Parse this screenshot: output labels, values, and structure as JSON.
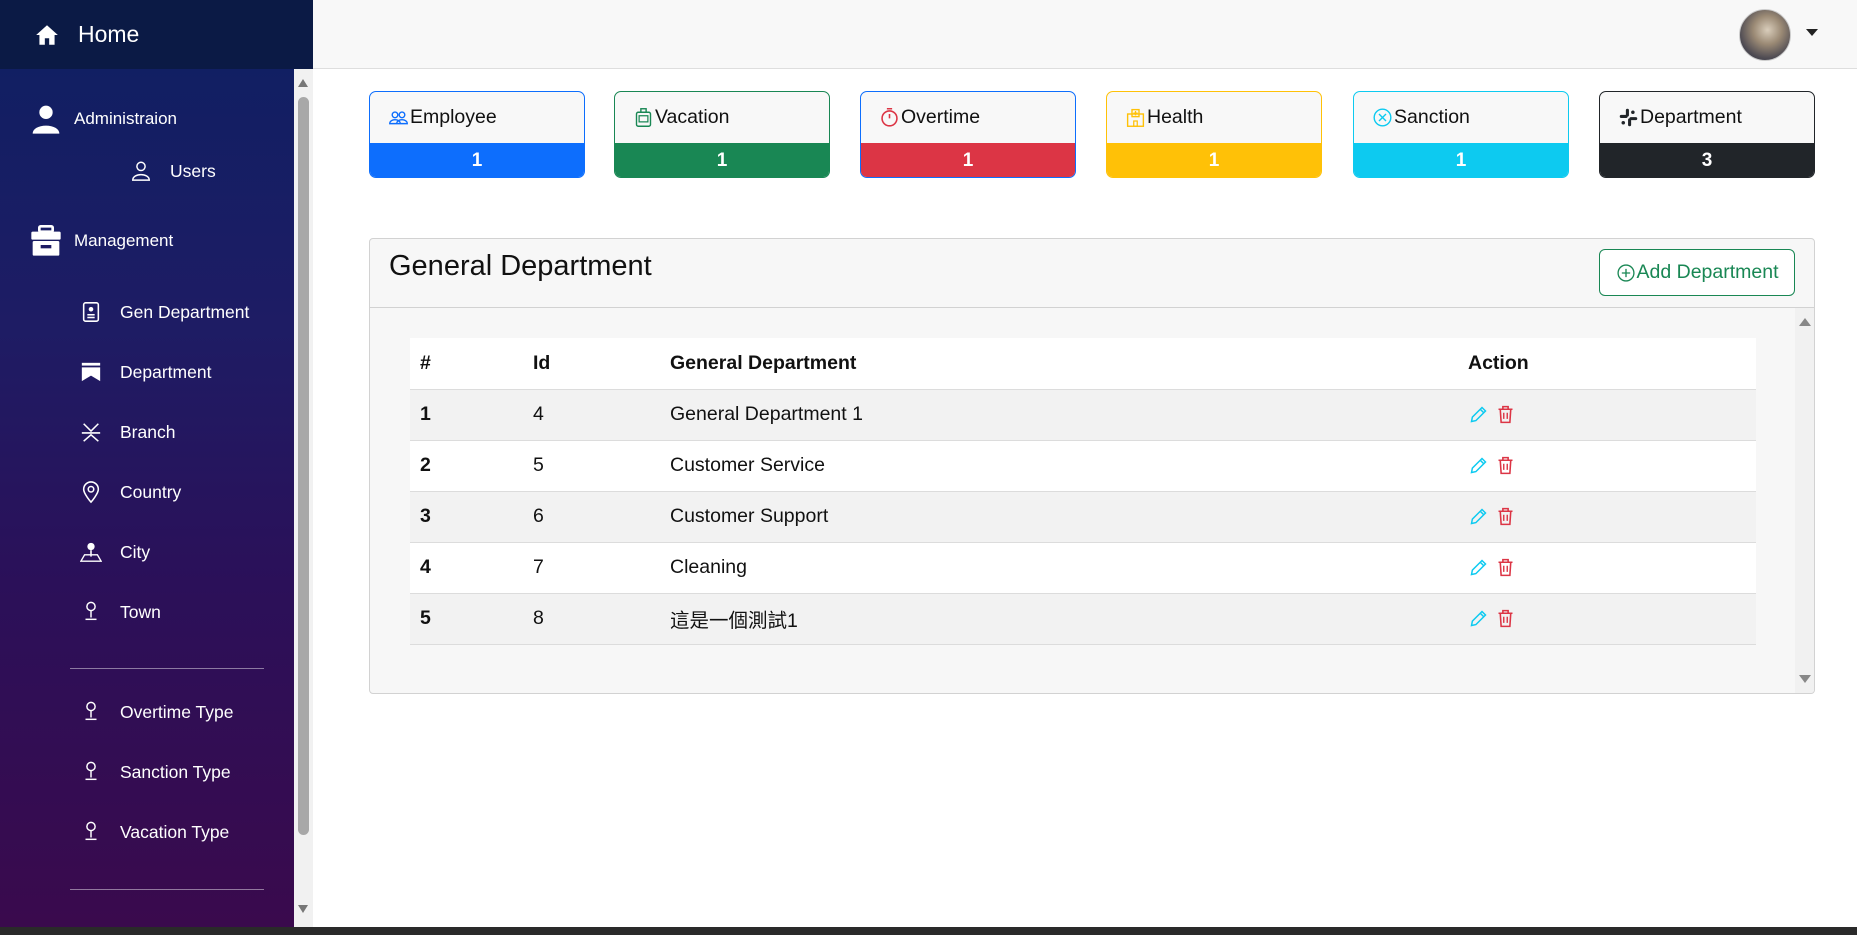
{
  "brand": {
    "label": "Home",
    "icon": "home-icon"
  },
  "sidebar": {
    "administration": {
      "label": "Administraion",
      "icon": "person-icon",
      "items": [
        {
          "label": "Users",
          "icon": "user-outline-icon"
        }
      ]
    },
    "management": {
      "label": "Management",
      "icon": "archive-box-icon",
      "items": [
        {
          "label": "Gen Department",
          "icon": "id-badge-icon"
        },
        {
          "label": "Department",
          "icon": "bookmarks-icon"
        },
        {
          "label": "Branch",
          "icon": "branch-icon"
        },
        {
          "label": "Country",
          "icon": "location-pin-icon"
        },
        {
          "label": "City",
          "icon": "person-map-pin-icon"
        },
        {
          "label": "Town",
          "icon": "pin-icon"
        }
      ],
      "types": [
        {
          "label": "Overtime Type",
          "icon": "pin-icon"
        },
        {
          "label": "Sanction Type",
          "icon": "pin-icon"
        },
        {
          "label": "Vacation Type",
          "icon": "pin-icon"
        }
      ]
    }
  },
  "stats": [
    {
      "label": "Employee",
      "count": "1",
      "color": "#0d6efd",
      "icon": "people-icon"
    },
    {
      "label": "Vacation",
      "count": "1",
      "color": "#198754",
      "icon": "suitcase-icon"
    },
    {
      "label": "Overtime",
      "count": "1",
      "color": "#dc3545",
      "icon": "stopwatch-icon"
    },
    {
      "label": "Health",
      "count": "1",
      "color": "#ffc107",
      "icon": "hospital-icon"
    },
    {
      "label": "Sanction",
      "count": "1",
      "color": "#0dcaf0",
      "icon": "x-circle-icon"
    },
    {
      "label": "Department",
      "count": "3",
      "color": "#212529",
      "icon": "slack-icon"
    }
  ],
  "panel": {
    "title": "General Department",
    "add_label": "Add Department",
    "columns": [
      "#",
      "Id",
      "General Department",
      "Action"
    ],
    "rows": [
      {
        "n": "1",
        "id": "4",
        "name": "General Department 1"
      },
      {
        "n": "2",
        "id": "5",
        "name": "Customer Service"
      },
      {
        "n": "3",
        "id": "6",
        "name": "Customer Support"
      },
      {
        "n": "4",
        "id": "7",
        "name": "Cleaning"
      },
      {
        "n": "5",
        "id": "8",
        "name": "這是一個測試1"
      }
    ]
  },
  "colors": {
    "edit": "#0dcaf0",
    "delete": "#dc3545",
    "add": "#198754"
  }
}
